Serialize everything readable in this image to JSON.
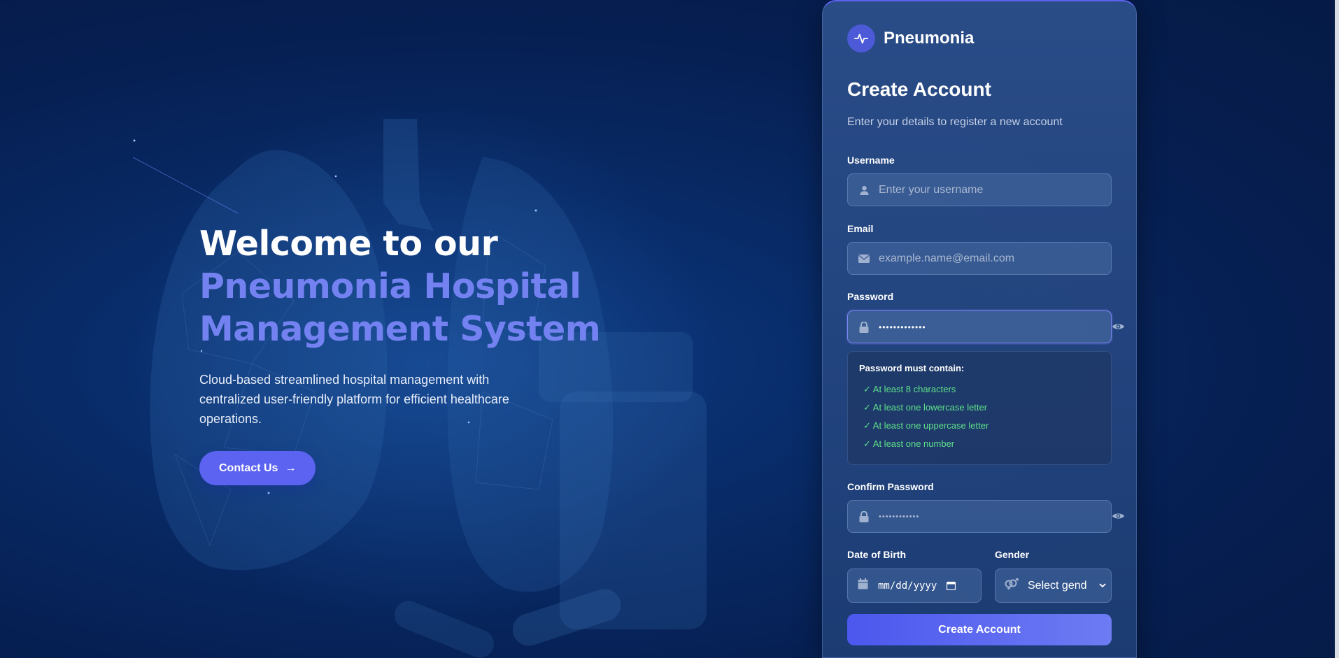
{
  "hero": {
    "line1": "Welcome to our",
    "line2": "Pneumonia Hospital",
    "line3": "Management System",
    "description": "Cloud-based streamlined hospital management with centralized user-friendly platform for efficient healthcare operations.",
    "contact_label": "Contact Us",
    "contact_icon": "arrow-right-icon"
  },
  "brand": {
    "name": "Pneumonia",
    "icon": "pulse-icon"
  },
  "form": {
    "title": "Create Account",
    "subtitle": "Enter your details to register a new account",
    "username": {
      "label": "Username",
      "placeholder": "Enter your username",
      "icon": "user-icon"
    },
    "email": {
      "label": "Email",
      "placeholder": "example.name@email.com",
      "icon": "envelope-icon"
    },
    "password": {
      "label": "Password",
      "value": "•••••••••••••",
      "icon": "lock-icon",
      "toggle_icon": "eye-icon"
    },
    "requirements": {
      "title": "Password must contain:",
      "items": [
        "✓ At least 8 characters",
        "✓ At least one lowercase letter",
        "✓ At least one uppercase letter",
        "✓ At least one number"
      ],
      "color": "#5ee08a"
    },
    "confirm_password": {
      "label": "Confirm Password",
      "placeholder": "••••••••••••",
      "icon": "lock-icon",
      "toggle_icon": "eye-icon"
    },
    "dob": {
      "label": "Date of Birth",
      "value": "mm/dd/yyyy",
      "icon": "calendar-icon"
    },
    "gender": {
      "label": "Gender",
      "value": "Select gend",
      "icon": "gender-icon"
    },
    "submit_label": "Create Account"
  },
  "colors": {
    "accent": "#5b63f0",
    "accent_text": "#7382f0",
    "background": "#061f52"
  }
}
